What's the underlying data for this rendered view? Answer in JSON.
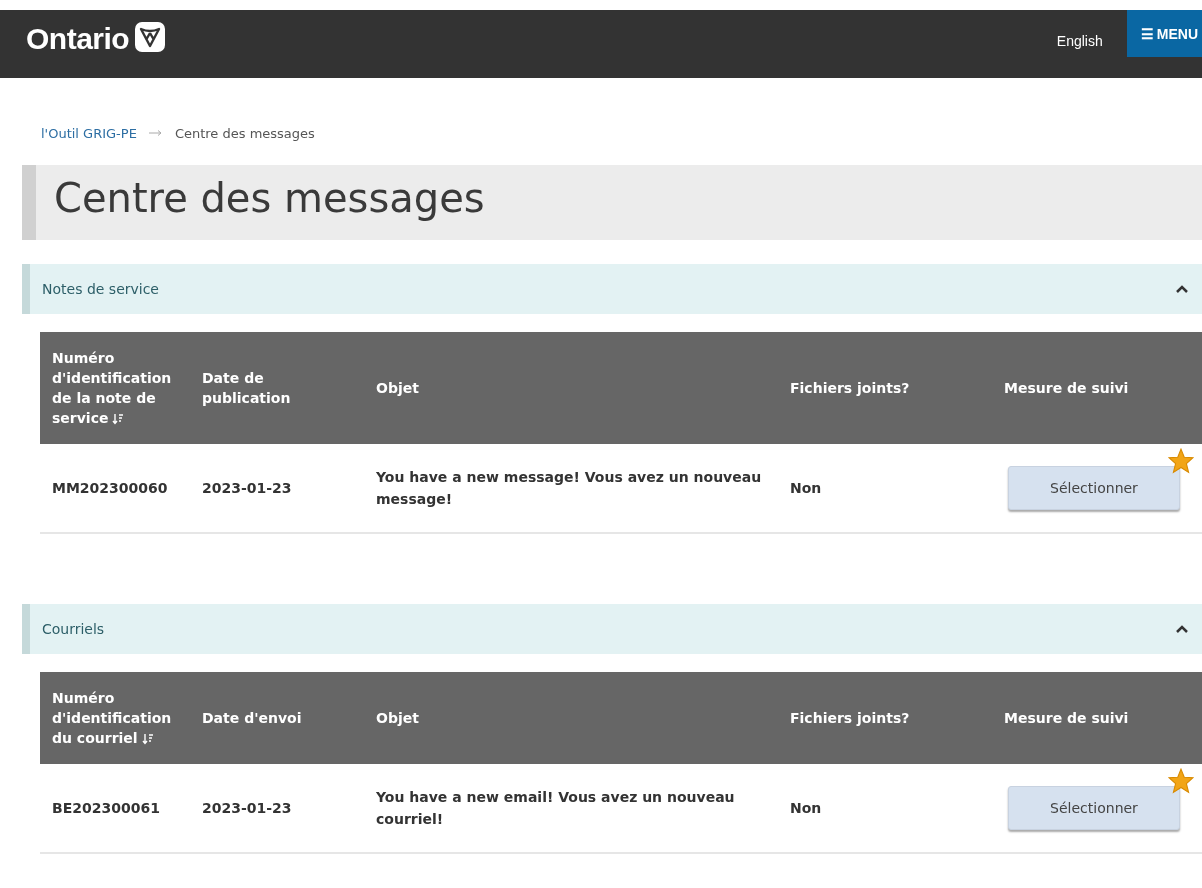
{
  "header": {
    "logo": "Ontario",
    "language_link": "English",
    "menu_button": {
      "icon": "☰",
      "label": "MENU"
    }
  },
  "breadcrumb": [
    {
      "label": "l'Outil GRIG-PE",
      "kind": "link"
    },
    {
      "label": "Centre des messages",
      "kind": "current"
    }
  ],
  "page_title": "Centre des messages",
  "sections": [
    {
      "title": "Notes de service",
      "expanded": true,
      "columns": [
        {
          "label": "Numéro d'identification de la note de service",
          "sortable": true
        },
        {
          "label": "Date de publication",
          "sortable": false
        },
        {
          "label": "Objet",
          "sortable": false
        },
        {
          "label": "Fichiers joints?",
          "sortable": false
        },
        {
          "label": "Mesure de suivi",
          "sortable": false
        }
      ],
      "rows": [
        {
          "id": "MM202300060",
          "date": "2023-01-23",
          "subject": "You have a new message! Vous avez un nouveau message!",
          "attachments": "Non",
          "action": "Sélectionner",
          "new": true
        }
      ]
    },
    {
      "title": "Courriels",
      "expanded": true,
      "columns": [
        {
          "label": "Numéro d'identification du courriel",
          "sortable": true
        },
        {
          "label": "Date d'envoi",
          "sortable": false
        },
        {
          "label": "Objet",
          "sortable": false
        },
        {
          "label": "Fichiers joints?",
          "sortable": false
        },
        {
          "label": "Mesure de suivi",
          "sortable": false
        }
      ],
      "rows": [
        {
          "id": "BE202300061",
          "date": "2023-01-23",
          "subject": "You have a new email! Vous avez un nouveau courriel!",
          "attachments": "Non",
          "action": "Sélectionner",
          "new": true
        }
      ]
    }
  ]
}
